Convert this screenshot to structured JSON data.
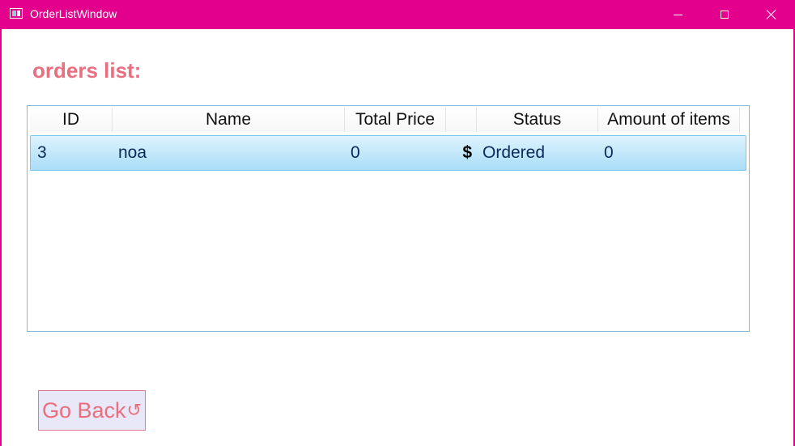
{
  "window": {
    "title": "OrderListWindow",
    "controls": {
      "minimize": "minimize-icon",
      "maximize": "maximize-icon",
      "close": "close-icon"
    }
  },
  "page": {
    "heading": "orders list:"
  },
  "orders_table": {
    "columns": [
      "ID",
      "Name",
      "Total Price",
      "",
      "Status",
      "Amount of items"
    ],
    "rows": [
      {
        "id": "3",
        "name": "noa",
        "total_price": "0",
        "currency": "$",
        "status": "Ordered",
        "amount_of_items": "0"
      }
    ]
  },
  "back_button": {
    "label": "Go Back",
    "icon": "↺"
  },
  "colors": {
    "titlebar": "#e3008c",
    "accent_text": "#ea6f7e",
    "selected_row": "#a9ddf8"
  }
}
